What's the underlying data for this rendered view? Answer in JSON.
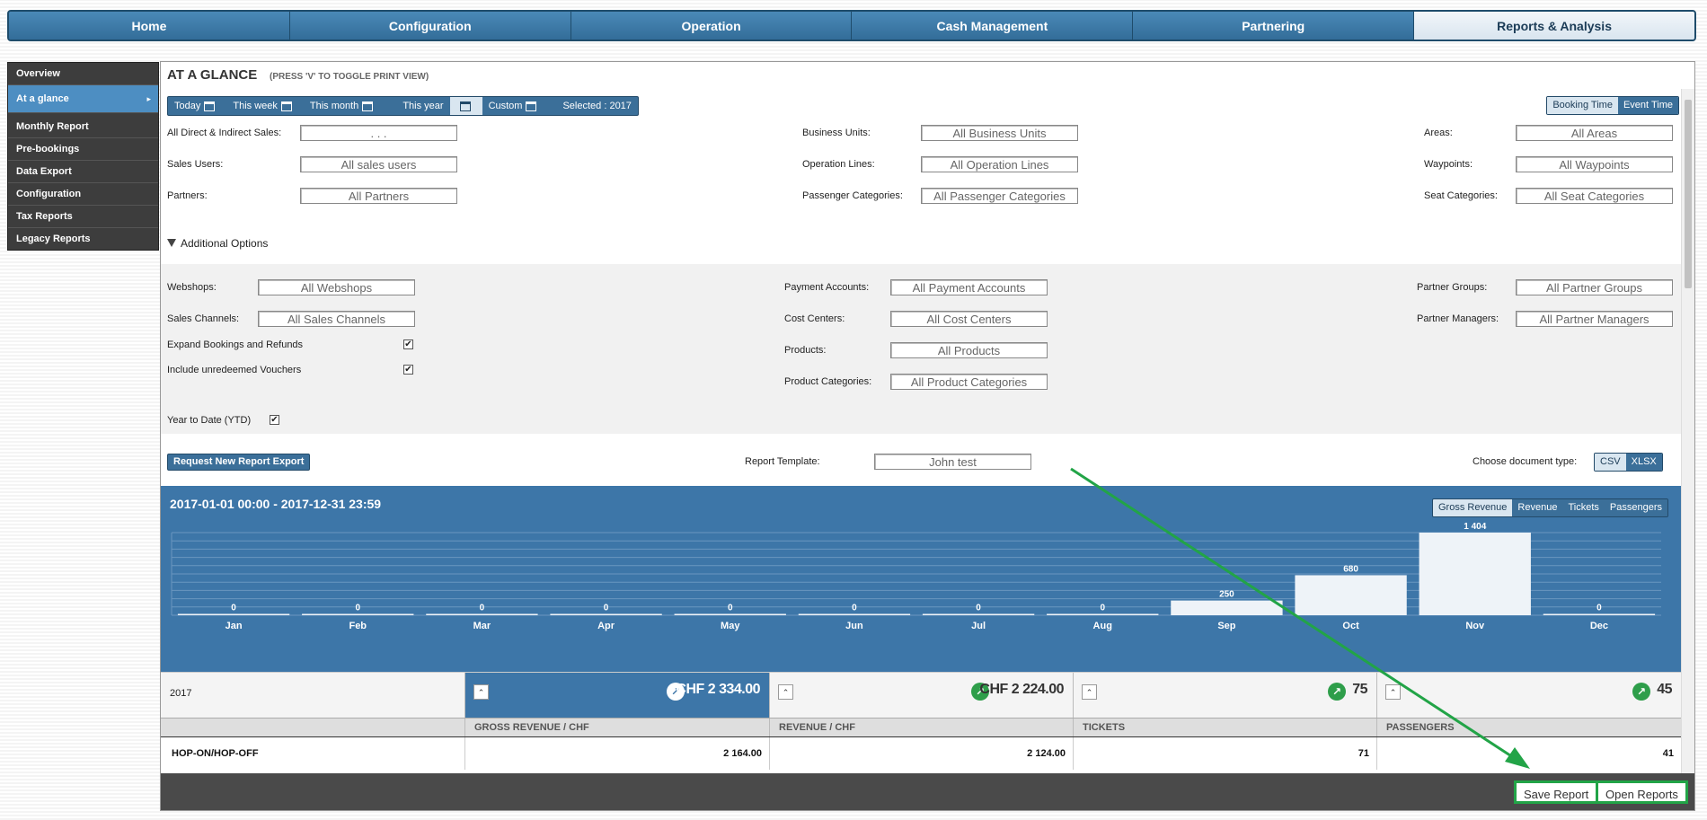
{
  "nav": {
    "tabs": [
      {
        "label": "Home"
      },
      {
        "label": "Configuration"
      },
      {
        "label": "Operation"
      },
      {
        "label": "Cash Management"
      },
      {
        "label": "Partnering"
      },
      {
        "label": "Reports & Analysis",
        "active": true
      }
    ]
  },
  "sidebar": {
    "items": [
      {
        "label": "Overview"
      },
      {
        "label": "At a glance",
        "active": true,
        "arrow": "▸"
      },
      {
        "label": "Monthly Report"
      },
      {
        "label": "Pre-bookings"
      },
      {
        "label": "Data Export"
      },
      {
        "label": "Configuration"
      },
      {
        "label": "Tax Reports"
      },
      {
        "label": "Legacy Reports"
      }
    ]
  },
  "header": {
    "title": "AT A GLANCE",
    "hint": "(PRESS 'V' TO TOGGLE PRINT VIEW)"
  },
  "time_toolbar": {
    "today": "Today",
    "this_week": "This week",
    "this_month": "This month",
    "this_year": "This year",
    "custom": "Custom",
    "selected": "Selected : 2017"
  },
  "time_mode": {
    "booking": "Booking Time",
    "event": "Event Time"
  },
  "filters": {
    "all_sales_label": "All Direct & Indirect Sales:",
    "all_sales_value": ". . .",
    "sales_users_label": "Sales Users:",
    "sales_users_value": "All sales users",
    "partners_label": "Partners:",
    "partners_value": "All Partners",
    "business_units_label": "Business Units:",
    "business_units_value": "All Business Units",
    "operation_lines_label": "Operation Lines:",
    "operation_lines_value": "All Operation Lines",
    "passenger_categories_label": "Passenger Categories:",
    "passenger_categories_value": "All Passenger Categories",
    "areas_label": "Areas:",
    "areas_value": "All Areas",
    "waypoints_label": "Waypoints:",
    "waypoints_value": "All Waypoints",
    "seat_categories_label": "Seat Categories:",
    "seat_categories_value": "All Seat Categories"
  },
  "additional": {
    "toggle_label": "Additional Options",
    "webshops_label": "Webshops:",
    "webshops_value": "All Webshops",
    "sales_channels_label": "Sales Channels:",
    "sales_channels_value": "All Sales Channels",
    "expand_label": "Expand Bookings and Refunds",
    "unredeemed_label": "Include unredeemed Vouchers",
    "payment_accounts_label": "Payment Accounts:",
    "payment_accounts_value": "All Payment Accounts",
    "cost_centers_label": "Cost Centers:",
    "cost_centers_value": "All Cost Centers",
    "products_label": "Products:",
    "products_value": "All Products",
    "product_categories_label": "Product Categories:",
    "product_categories_value": "All Product Categories",
    "partner_groups_label": "Partner Groups:",
    "partner_groups_value": "All Partner Groups",
    "partner_managers_label": "Partner Managers:",
    "partner_managers_value": "All Partner Managers",
    "ytd_label": "Year to Date (YTD)",
    "check_mark": "✔"
  },
  "export": {
    "request_label": "Request New Report Export",
    "template_label": "Report Template:",
    "template_value": "John test",
    "doctype_label": "Choose document type:",
    "csv": "CSV",
    "xlsx": "XLSX"
  },
  "chart_panel": {
    "range": "2017-01-01 00:00 - 2017-12-31 23:59",
    "metrics": [
      "Gross Revenue",
      "Revenue",
      "Tickets",
      "Passengers"
    ]
  },
  "chart_data": {
    "type": "bar",
    "categories": [
      "Jan",
      "Feb",
      "Mar",
      "Apr",
      "May",
      "Jun",
      "Jul",
      "Aug",
      "Sep",
      "Oct",
      "Nov",
      "Dec"
    ],
    "values": [
      0,
      0,
      0,
      0,
      0,
      0,
      0,
      0,
      250,
      680,
      1404,
      0
    ],
    "value_labels": [
      "0",
      "0",
      "0",
      "0",
      "0",
      "0",
      "0",
      "0",
      "250",
      "680",
      "1 404",
      "0"
    ],
    "ylim": [
      0,
      1404
    ],
    "grid": true,
    "colors": {
      "background": "#3d76a8",
      "bar": "#eef3f8",
      "grid": "#6a97bf"
    }
  },
  "summary": {
    "year": "2017",
    "caret": "⌃",
    "trend": "↗",
    "gross_revenue": "CHF 2 334.00",
    "revenue": "CHF 2 224.00",
    "tickets": "75",
    "passengers": "45"
  },
  "table": {
    "headers": [
      "GROSS REVENUE / CHF",
      "REVENUE / CHF",
      "TICKETS",
      "PASSENGERS"
    ],
    "rows": [
      {
        "name": "HOP-ON/HOP-OFF",
        "values": [
          "2 164.00",
          "2 124.00",
          "71",
          "41"
        ]
      }
    ]
  },
  "bottom": {
    "save": "Save Report",
    "open": "Open Reports"
  },
  "colors": {
    "accent": "#3d76a8",
    "highlight": "#22a447",
    "dark": "#4a4a4a"
  }
}
